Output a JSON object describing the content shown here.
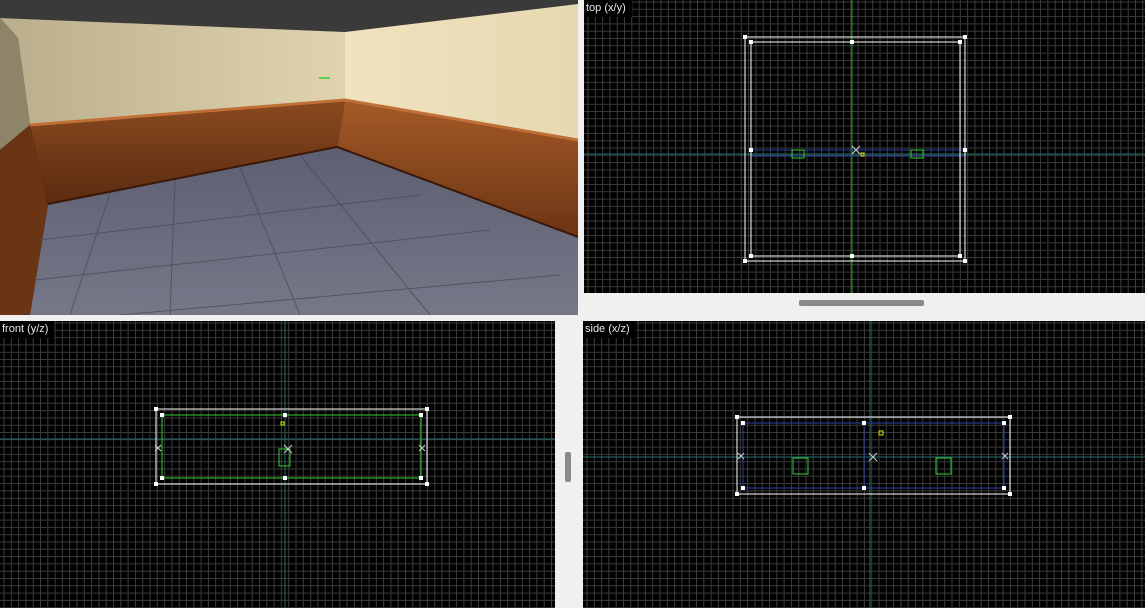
{
  "viewports": {
    "camera": {
      "label": "3D camera view"
    },
    "top": {
      "label": "top (x/y)"
    },
    "front": {
      "label": "front (y/z)"
    },
    "side": {
      "label": "side (x/z)"
    }
  },
  "colors": {
    "background": "#000000",
    "grid": "#3b3b3b",
    "grid_major": "#5a5a5a",
    "axis": "#1f6b6b",
    "brush_selected": "#ffffff",
    "brush_green": "#2fd02f",
    "brush_blue": "#2a3fa8",
    "entity_yellow": "#e8e800",
    "ui_gray": "#f0f0f0"
  },
  "icons": [
    "vertex-handle",
    "center-cross-marker",
    "entity-box"
  ]
}
